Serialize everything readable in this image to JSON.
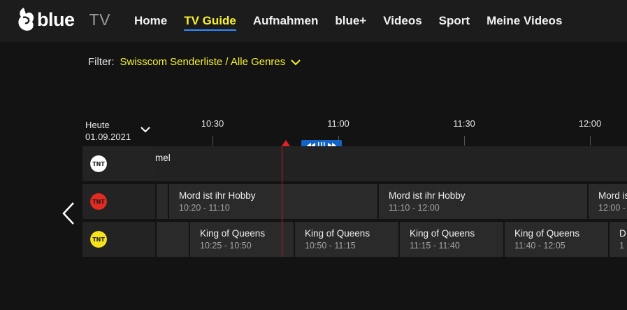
{
  "header": {
    "brand": "blue",
    "product": "TV",
    "nav": [
      {
        "label": "Home",
        "active": false
      },
      {
        "label": "TV Guide",
        "active": true
      },
      {
        "label": "Aufnahmen",
        "active": false
      },
      {
        "label": "blue+",
        "active": false
      },
      {
        "label": "Videos",
        "active": false
      },
      {
        "label": "Sport",
        "active": false
      },
      {
        "label": "Meine Videos",
        "active": false
      }
    ]
  },
  "filter": {
    "label": "Filter:",
    "value": "Swisscom Senderliste / Alle Genres"
  },
  "date": {
    "day": "Heute",
    "date": "01.09.2021"
  },
  "timeline": {
    "ticks": [
      "10:30",
      "11:00",
      "11:30",
      "12:00"
    ]
  },
  "channels": [
    {
      "logo_color": "#ffffff",
      "logo_text": "TNT",
      "programs": [
        {
          "title": "mel",
          "time": ""
        }
      ]
    },
    {
      "logo_color": "#e02a22",
      "logo_text": "TNT",
      "programs": [
        {
          "title": "Mord ist ihr Hobby",
          "time": "10:20 - 11:10"
        },
        {
          "title": "Mord ist ihr Hobby",
          "time": "11:10 - 12:00"
        },
        {
          "title": "Mord ist",
          "time": "12:00 -"
        }
      ]
    },
    {
      "logo_color": "#f6e21c",
      "logo_text": "TNT",
      "programs": [
        {
          "title": "King of Queens",
          "time": "10:25 - 10:50"
        },
        {
          "title": "King of Queens",
          "time": "10:50 - 11:15"
        },
        {
          "title": "King of Queens",
          "time": "11:15 - 11:40"
        },
        {
          "title": "King of Queens",
          "time": "11:40 - 12:05"
        },
        {
          "title": "D",
          "time": "1"
        }
      ]
    }
  ],
  "icons": {
    "brand": "swisscom-logo-icon",
    "filter_dropdown": "chevron-down-icon",
    "date_dropdown": "chevron-down-icon",
    "now_marker": "triangle-up-icon",
    "scrubber": "rewind-forward-scrubber-icon",
    "prev": "chevron-left-icon"
  },
  "colors": {
    "accent_yellow": "#f6f135",
    "accent_blue": "#2f8bff",
    "now_red": "#e41e2b"
  }
}
